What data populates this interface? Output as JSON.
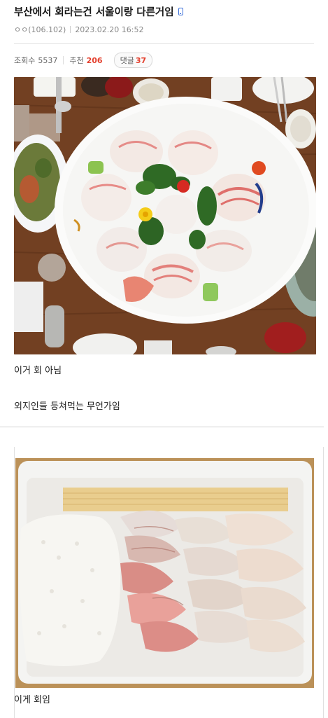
{
  "post": {
    "title": "부산에서 회라는건 서울이랑 다른거임",
    "author": "ㅇㅇ(106.102)",
    "date": "2023.02.20 16:52",
    "stats": {
      "views_label": "조회수",
      "views": "5537",
      "recommend_label": "추천",
      "recommend": "206",
      "comments_label": "댓글",
      "comments": "37"
    },
    "captions": {
      "photo1_line1": "이거 회 아님",
      "photo1_line2": "외지인들 등쳐먹는 무언가임",
      "photo2_line1": "이게 회임"
    }
  },
  "colors": {
    "accent_red": "#e4412f",
    "device_icon_blue": "#3b6fd8"
  },
  "icons": {
    "device": "mobile-device-icon"
  }
}
